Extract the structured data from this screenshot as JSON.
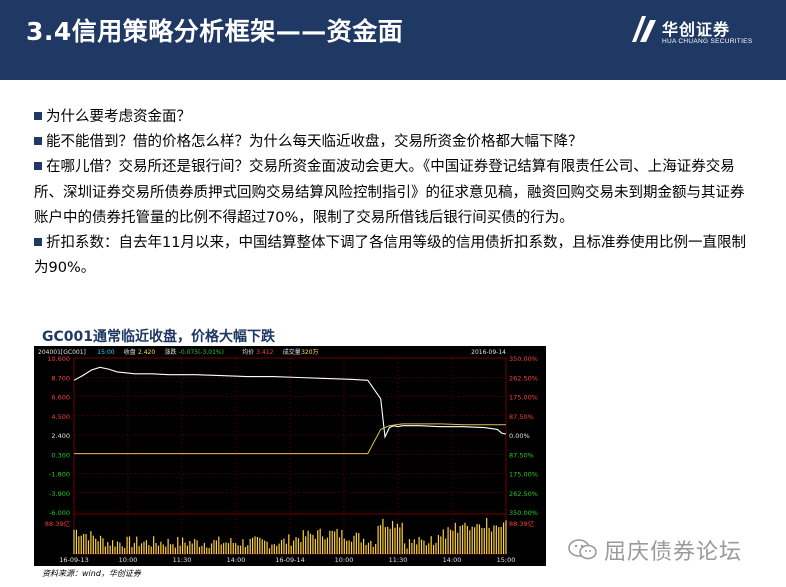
{
  "header": {
    "title": "3.4信用策略分析框架——资金面",
    "logo_name": "华创证券",
    "logo_sub": "HUA CHUANG SECURITIES",
    "bg_color": "#1f3864"
  },
  "bullets": [
    "为什么要考虑资金面？",
    "能不能借到？借的价格怎么样？为什么每天临近收盘，交易所资金价格都大幅下降？",
    "在哪儿借？交易所还是银行间？交易所资金面波动会更大。《中国证券登记结算有限责任公司、上海证券交易所、深圳证券交易所债券质押式回购交易结算风险控制指引》的征求意见稿，融资回购交易未到期金额与其证券账户中的债券托管量的比例不得超过70%，限制了交易所借钱后银行间买债的行为。",
    "折扣系数：自去年11月以来，中国结算整体下调了各信用等级的信用债折扣系数，且标准券使用比例一直限制为90%。"
  ],
  "chart_title": "GC001通常临近收盘，价格大幅下跌",
  "chart_data": {
    "type": "line",
    "header_labels": [
      "204001[GC001]",
      "15:00",
      "收盘",
      "2.420",
      "涨跌",
      "-0.075(-3.01%)",
      "均价",
      "3.412",
      "成交量",
      "320万",
      "2016-09-14"
    ],
    "left_ticks": [
      "10.600",
      "8.700",
      "6.600",
      "4.500",
      "2.400",
      "0.300",
      "-1.800",
      "-3.900",
      "-6.000"
    ],
    "right_ticks": [
      "350.00%",
      "262.50%",
      "175.00%",
      "87.50%",
      "0.00%",
      "87.50%",
      "175.00%",
      "262.50%",
      "350.00%"
    ],
    "ylim": [
      -6.0,
      10.6
    ],
    "volume_label": "88.39亿",
    "x_ticks": [
      "16-09-13",
      "10:00",
      "11:30",
      "14:00",
      "16-09-14",
      "10:00",
      "11:30",
      "14:00",
      "15:00"
    ],
    "series": [
      {
        "color": "#ffffff",
        "x": [
          0,
          2,
          4,
          6,
          8,
          10,
          14,
          18,
          22,
          28,
          34,
          40,
          46,
          52,
          58,
          64,
          68,
          71,
          72,
          73,
          74,
          75,
          76,
          80,
          85,
          90,
          95,
          98,
          99,
          100
        ],
        "values": [
          8.2,
          8.7,
          9.3,
          9.6,
          9.4,
          9.1,
          8.9,
          8.9,
          8.8,
          8.8,
          8.7,
          8.6,
          8.6,
          8.5,
          8.4,
          8.3,
          8.2,
          6.2,
          2.1,
          3.1,
          3.3,
          3.2,
          3.3,
          3.3,
          3.2,
          3.2,
          3.1,
          2.9,
          2.5,
          2.4
        ]
      },
      {
        "color": "#e0c050",
        "x": [
          0,
          5,
          10,
          20,
          30,
          40,
          50,
          60,
          68,
          71,
          72,
          73,
          76,
          80,
          85,
          90,
          95,
          100
        ],
        "values": [
          0.3,
          0.3,
          0.3,
          0.3,
          0.3,
          0.3,
          0.3,
          0.3,
          0.3,
          2.9,
          3.1,
          3.3,
          3.5,
          3.5,
          3.5,
          3.4,
          3.4,
          3.4
        ]
      }
    ]
  },
  "source": "资料来源：wind，华创证券",
  "watermark": "屈庆债券论坛"
}
